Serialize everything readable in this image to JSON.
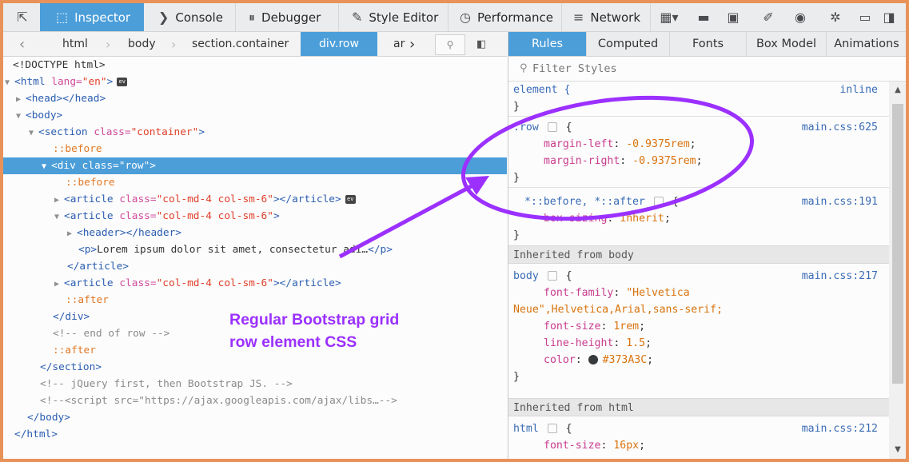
{
  "toolbar": {
    "tabs": [
      "Inspector",
      "Console",
      "Debugger",
      "Style Editor",
      "Performance",
      "Network"
    ]
  },
  "breadcrumb": {
    "items": [
      "html",
      "body",
      "section.container",
      "div.row",
      "ar"
    ]
  },
  "markup": {
    "lines": [
      {
        "t": "<!DOCTYPE html>"
      },
      {
        "tag1": "<html ",
        "attr": "lang=",
        "val": "\"en\"",
        "tag2": ">"
      },
      {
        "tag1": "<head></head>"
      },
      {
        "tag1": "<body>"
      },
      {
        "tag1": "<section ",
        "attr": "class=",
        "val": "\"container\"",
        "tag2": ">"
      },
      {
        "pseudo": "::before"
      },
      {
        "tag1": "<div ",
        "attr": "class=",
        "val": "\"row\"",
        "tag2": ">"
      },
      {
        "pseudo": "::before"
      },
      {
        "tag1": "<article ",
        "attr": "class=",
        "val": "\"col-md-4 col-sm-6\"",
        "tag2": "></article>"
      },
      {
        "tag1": "<article ",
        "attr": "class=",
        "val": "\"col-md-4 col-sm-6\"",
        "tag2": ">"
      },
      {
        "tag1": "<header></header>"
      },
      {
        "tag1": "<p>",
        "text": "Lorem ipsum dolor sit amet, consectetur adi…",
        "tag2": "</p>"
      },
      {
        "tag1": "</article>"
      },
      {
        "tag1": "<article ",
        "attr": "class=",
        "val": "\"col-md-4 col-sm-6\"",
        "tag2": "></article>"
      },
      {
        "pseudo": "::after"
      },
      {
        "tag1": "</div>"
      },
      {
        "comment": "<!-- end of row -->"
      },
      {
        "pseudo": "::after"
      },
      {
        "tag1": "</section>"
      },
      {
        "comment": "<!-- jQuery first, then Bootstrap JS. -->"
      },
      {
        "comment": "<!--<script src=\"https://ajax.googleapis.com/ajax/libs…-->"
      },
      {
        "tag1": "</body>"
      },
      {
        "tag1": "</html>"
      }
    ]
  },
  "sidepanel": {
    "tabs": [
      "Rules",
      "Computed",
      "Fonts",
      "Box Model",
      "Animations"
    ],
    "filter_placeholder": "Filter Styles"
  },
  "rules": {
    "element_selector": "element {",
    "element_source": "inline",
    "close_brace": "}",
    "row_selector": ".row",
    "row_source": "main.css:625",
    "row_props": [
      {
        "name": "margin-left",
        "value": "-0.9375rem"
      },
      {
        "name": "margin-right",
        "value": "-0.9375rem"
      }
    ],
    "universal_selector": "*::before, *::after",
    "universal_source": "main.css:191",
    "universal_props": [
      {
        "name": "box-sizing",
        "value": "inherit"
      }
    ],
    "inherited_body": "Inherited from body",
    "body_selector": "body",
    "body_source": "main.css:217",
    "body_props": [
      {
        "name": "font-family",
        "value": "\"Helvetica"
      },
      {
        "name": "",
        "value": "Neue\",Helvetica,Arial,sans-serif;"
      },
      {
        "name": "font-size",
        "value": "1rem"
      },
      {
        "name": "line-height",
        "value": "1.5"
      },
      {
        "name": "color",
        "value": "#373A3C"
      }
    ],
    "inherited_html": "Inherited from html",
    "html_selector": "html",
    "html_source": "main.css:212",
    "html_props": [
      {
        "name": "font-size",
        "value": "16px"
      }
    ]
  },
  "annotation": {
    "text_line1": "Regular Bootstrap grid",
    "text_line2": "row element CSS",
    "color": "#9b30ff"
  }
}
